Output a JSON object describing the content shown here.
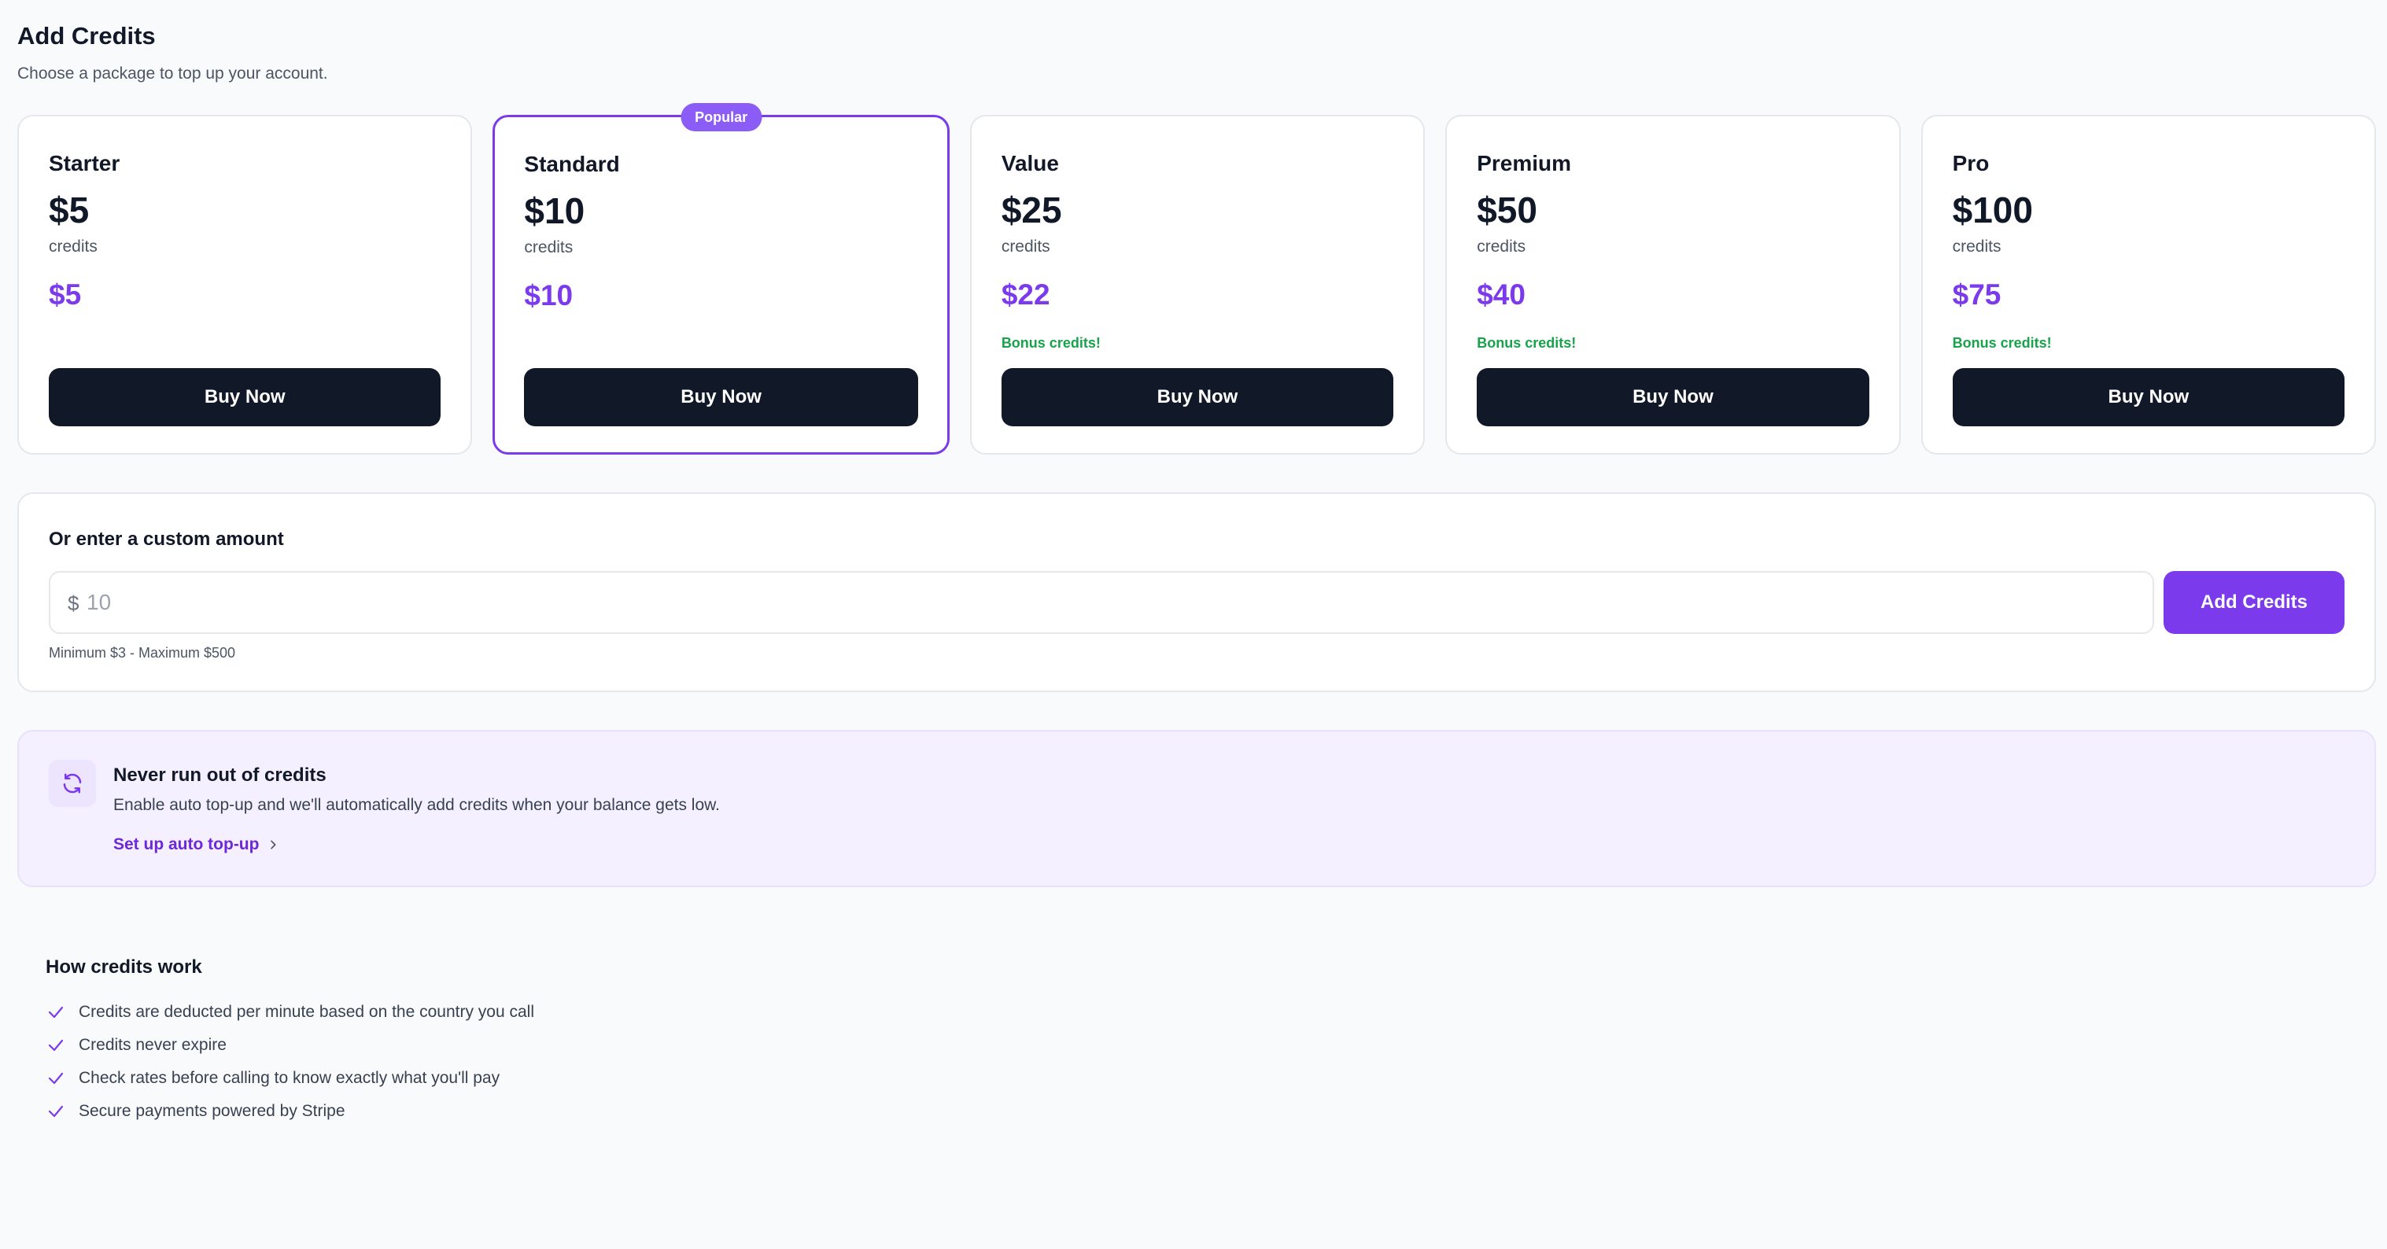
{
  "header": {
    "title": "Add Credits",
    "subtitle": "Choose a package to top up your account."
  },
  "packages": [
    {
      "name": "Starter",
      "credits": "$5",
      "credits_label": "credits",
      "price": "$5",
      "bonus": "",
      "button": "Buy Now",
      "badge": ""
    },
    {
      "name": "Standard",
      "credits": "$10",
      "credits_label": "credits",
      "price": "$10",
      "bonus": "",
      "button": "Buy Now",
      "badge": "Popular"
    },
    {
      "name": "Value",
      "credits": "$25",
      "credits_label": "credits",
      "price": "$22",
      "bonus": "Bonus credits!",
      "button": "Buy Now",
      "badge": ""
    },
    {
      "name": "Premium",
      "credits": "$50",
      "credits_label": "credits",
      "price": "$40",
      "bonus": "Bonus credits!",
      "button": "Buy Now",
      "badge": ""
    },
    {
      "name": "Pro",
      "credits": "$100",
      "credits_label": "credits",
      "price": "$75",
      "bonus": "Bonus credits!",
      "button": "Buy Now",
      "badge": ""
    }
  ],
  "custom_amount": {
    "title": "Or enter a custom amount",
    "currency_symbol": "$",
    "value": "",
    "placeholder": "10",
    "button": "Add Credits",
    "limits": "Minimum $3 - Maximum $500"
  },
  "auto_topup": {
    "icon": "refresh-icon",
    "title": "Never run out of credits",
    "description": "Enable auto top-up and we'll automatically add credits when your balance gets low.",
    "link": "Set up auto top-up"
  },
  "how_credits_work": {
    "title": "How credits work",
    "items": [
      "Credits are deducted per minute based on the country you call",
      "Credits never expire",
      "Check rates before calling to know exactly what you'll pay",
      "Secure payments powered by Stripe"
    ]
  },
  "colors": {
    "accent": "#7c3aed",
    "dark_button": "#111827",
    "bonus_green": "#16a34a",
    "background": "#f9fafb"
  }
}
